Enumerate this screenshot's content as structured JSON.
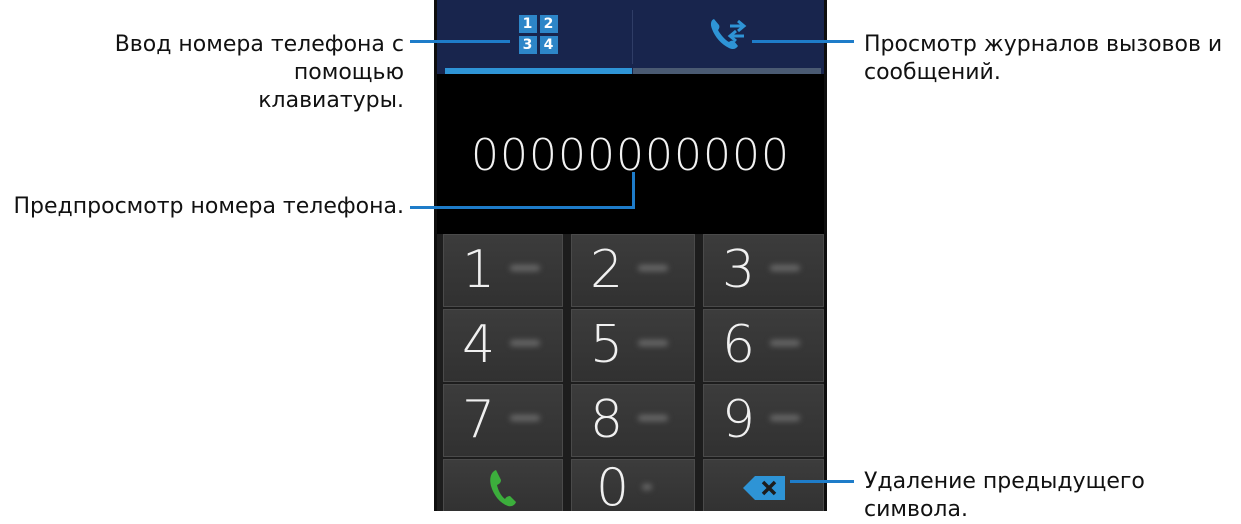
{
  "callouts": {
    "keypad_tab": [
      "Ввод номера телефона с помощью",
      "клавиатуры."
    ],
    "logs_tab": [
      "Просмотр журналов вызовов и",
      "сообщений."
    ],
    "number_preview": "Предпросмотр номера телефона.",
    "backspace": "Удаление предыдущего символа."
  },
  "tabs": {
    "keypad_icon_digits": [
      "1",
      "2",
      "3",
      "4"
    ],
    "keypad_icon": "keypad-grid-icon",
    "logs_icon": "call-log-icon"
  },
  "display": {
    "number": "00000000000"
  },
  "keypad": {
    "keys": [
      "1",
      "2",
      "3",
      "4",
      "5",
      "6",
      "7",
      "8",
      "9"
    ],
    "zero": "0",
    "call_icon": "phone-handset-icon",
    "backspace_icon": "backspace-icon"
  },
  "colors": {
    "accent": "#2e94d6",
    "call_green": "#3cae3c",
    "tabbar": "#18254d",
    "leader": "#1e7cc9"
  }
}
